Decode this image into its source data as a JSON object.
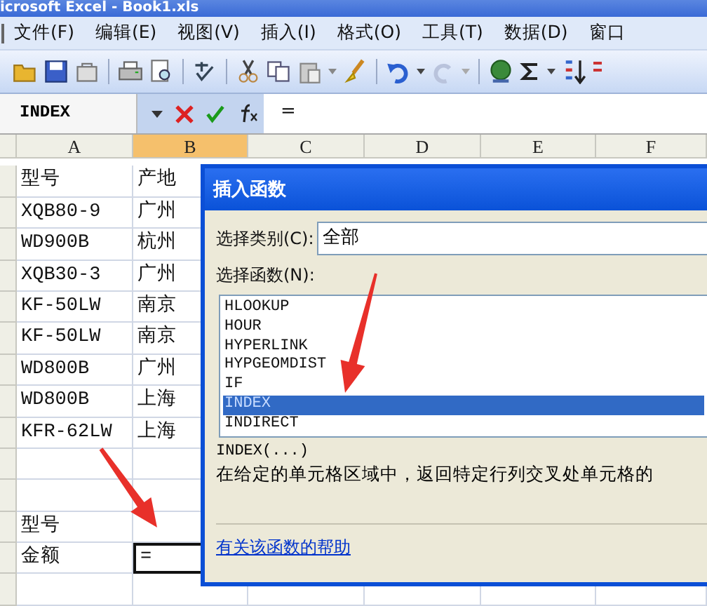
{
  "window": {
    "title": "icrosoft Excel - Book1.xls"
  },
  "menu": [
    "文件(F)",
    "编辑(E)",
    "视图(V)",
    "插入(I)",
    "格式(O)",
    "工具(T)",
    "数据(D)",
    "窗口"
  ],
  "formula_bar": {
    "name_box": "INDEX",
    "formula": "="
  },
  "columns": [
    {
      "label": "A",
      "selected": false
    },
    {
      "label": "B",
      "selected": true
    },
    {
      "label": "C",
      "selected": false
    },
    {
      "label": "D",
      "selected": false
    },
    {
      "label": "E",
      "selected": false
    },
    {
      "label": "F",
      "selected": false
    }
  ],
  "rows": [
    {
      "kind": "data",
      "cells": [
        {
          "text": "型号",
          "active": false
        },
        {
          "text": "产地",
          "active": false
        }
      ]
    },
    {
      "kind": "data",
      "cells": [
        {
          "text": "XQB80-9",
          "active": false
        },
        {
          "text": "广州",
          "active": false
        }
      ]
    },
    {
      "kind": "data",
      "cells": [
        {
          "text": "WD900B",
          "active": false
        },
        {
          "text": "杭州",
          "active": false
        }
      ]
    },
    {
      "kind": "data",
      "cells": [
        {
          "text": "XQB30-3",
          "active": false
        },
        {
          "text": "广州",
          "active": false
        }
      ]
    },
    {
      "kind": "data",
      "cells": [
        {
          "text": "KF-50LW",
          "active": false
        },
        {
          "text": "南京",
          "active": false
        }
      ]
    },
    {
      "kind": "data",
      "cells": [
        {
          "text": "KF-50LW",
          "active": false
        },
        {
          "text": "南京",
          "active": false
        }
      ]
    },
    {
      "kind": "data",
      "cells": [
        {
          "text": "WD800B",
          "active": false
        },
        {
          "text": "广州",
          "active": false
        }
      ]
    },
    {
      "kind": "data",
      "cells": [
        {
          "text": "WD800B",
          "active": false
        },
        {
          "text": "上海",
          "active": false
        }
      ]
    },
    {
      "kind": "data",
      "cells": [
        {
          "text": "KFR-62LW",
          "active": false
        },
        {
          "text": "上海",
          "active": false
        }
      ]
    },
    {
      "kind": "empty"
    },
    {
      "kind": "empty"
    },
    {
      "kind": "data",
      "cells": [
        {
          "text": "型号",
          "active": false
        }
      ]
    },
    {
      "kind": "data",
      "cells": [
        {
          "text": "金额",
          "active": false
        },
        {
          "text": "=",
          "active": true
        }
      ]
    },
    {
      "kind": "empty"
    }
  ],
  "dialog": {
    "title": "插入函数",
    "category_label": "选择类别(C):",
    "category_value": "全部",
    "function_label": "选择函数(N):",
    "functions": [
      {
        "name": "HLOOKUP",
        "selected": false
      },
      {
        "name": "HOUR",
        "selected": false
      },
      {
        "name": "HYPERLINK",
        "selected": false
      },
      {
        "name": "HYPGEOMDIST",
        "selected": false
      },
      {
        "name": "IF",
        "selected": false
      },
      {
        "name": "INDEX",
        "selected": true
      },
      {
        "name": "INDIRECT",
        "selected": false
      }
    ],
    "signature": "INDEX(...)",
    "description": "在给定的单元格区域中，返回特定行列交叉处单元格的",
    "help_link": "有关该函数的帮助"
  }
}
